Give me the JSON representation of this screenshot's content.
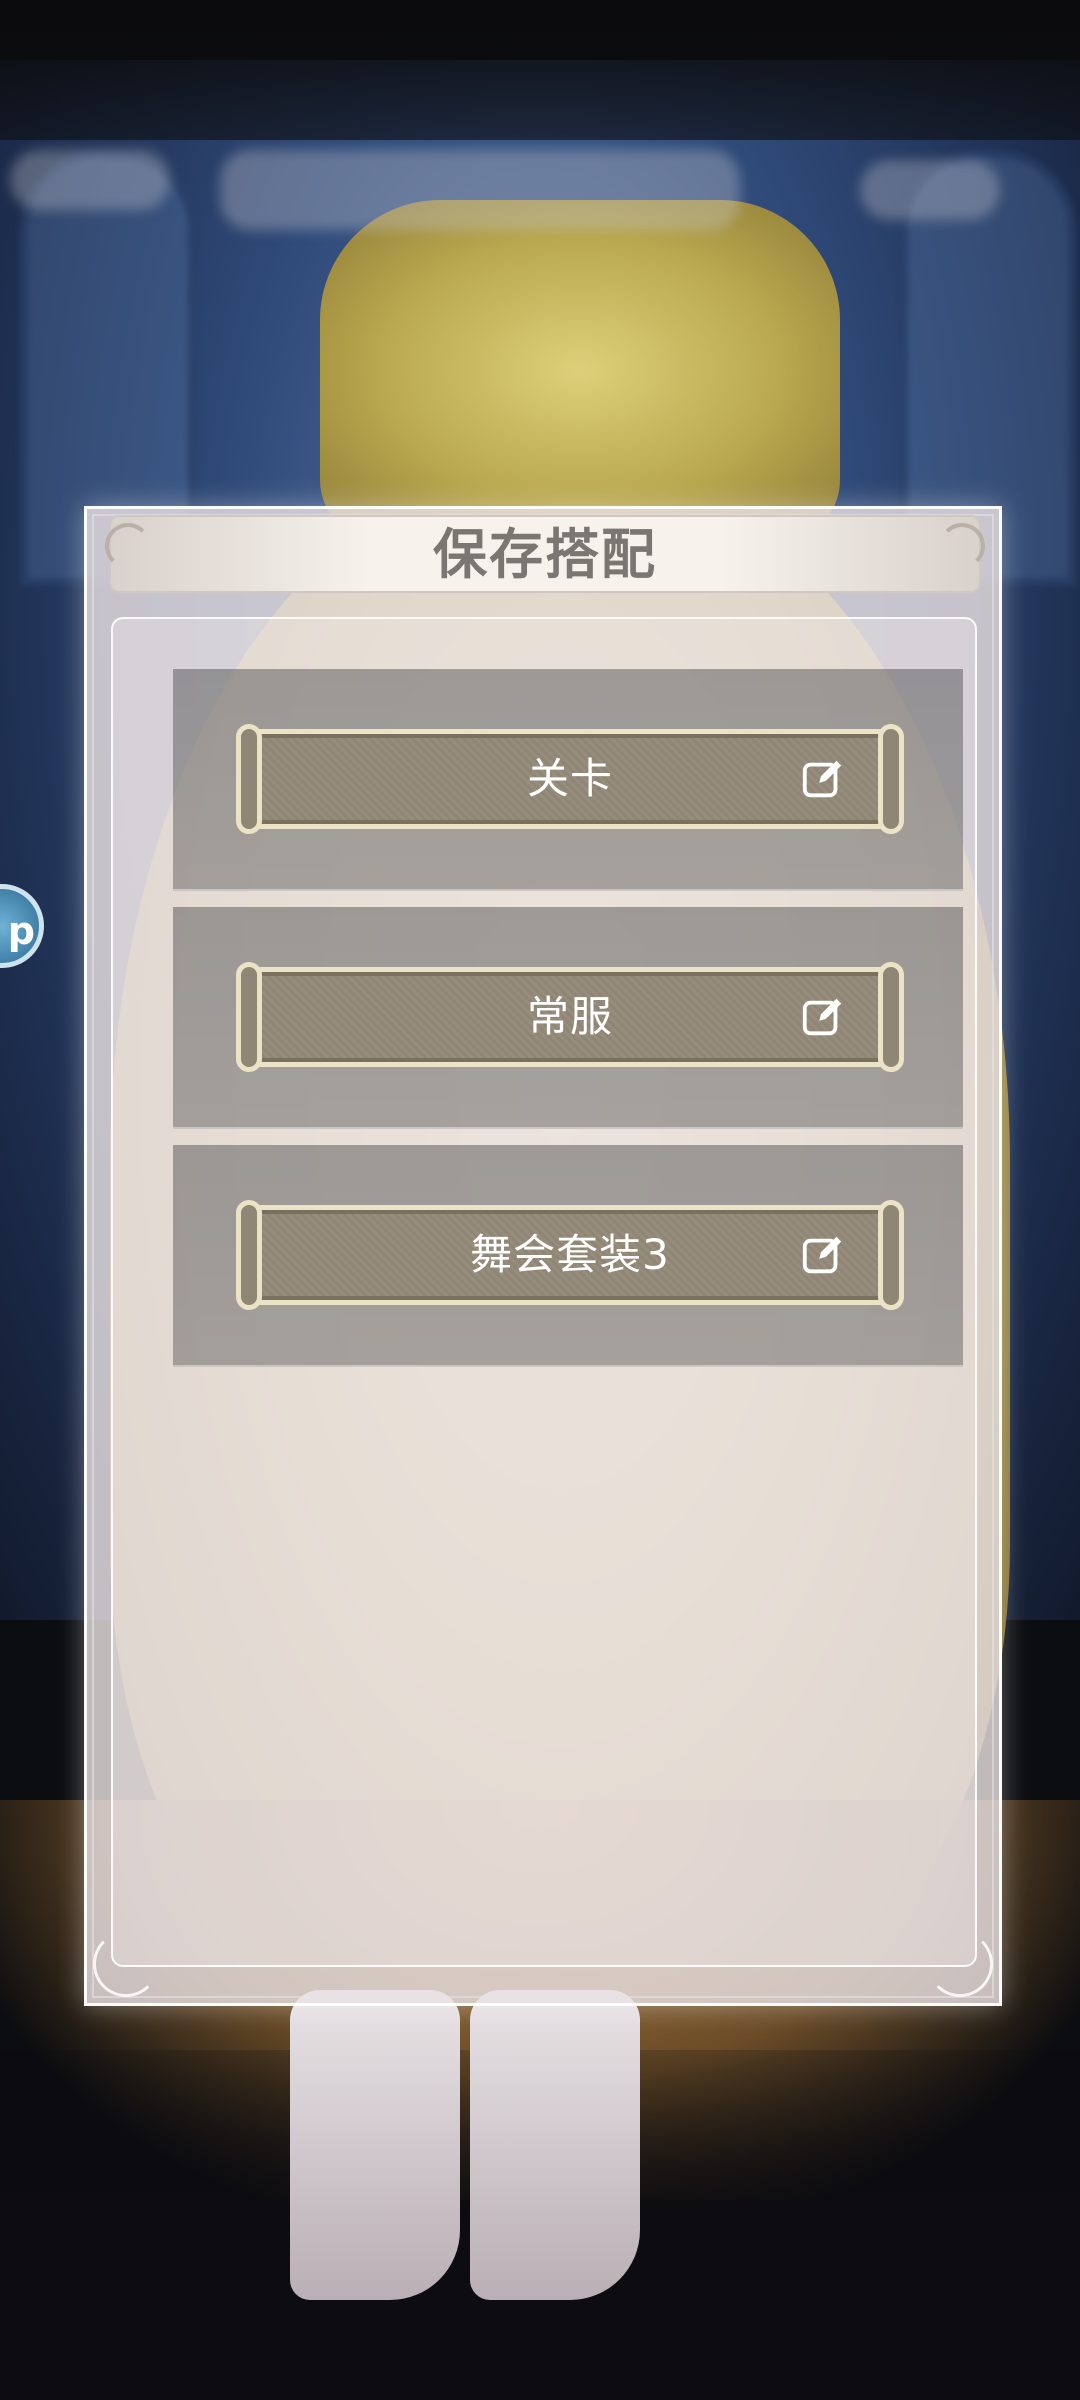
{
  "dialog": {
    "title": "保存搭配",
    "slots": [
      {
        "label": "关卡",
        "action_icon": "edit-icon"
      },
      {
        "label": "常服",
        "action_icon": "edit-icon"
      },
      {
        "label": "舞会套装3",
        "action_icon": "edit-icon"
      }
    ]
  },
  "background": {
    "side_button_text": "p"
  },
  "colors": {
    "panel_bg": "#e9e1e2",
    "title_text": "#7c7672",
    "slot_button": "#8f8676",
    "slot_border": "#ece3c6",
    "slot_text": "#ffffff"
  }
}
